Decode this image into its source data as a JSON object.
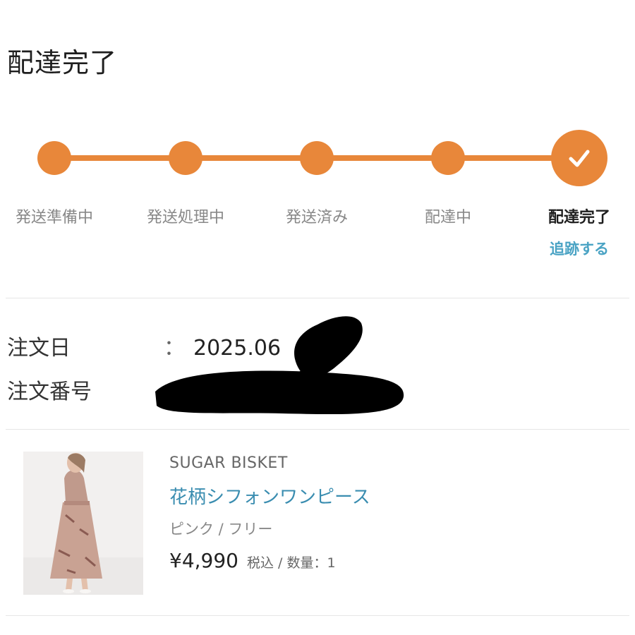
{
  "header": {
    "title": "配達完了"
  },
  "progress": {
    "accent_color": "#e8873a",
    "steps": [
      {
        "label": "発送準備中",
        "state": "done"
      },
      {
        "label": "発送処理中",
        "state": "done"
      },
      {
        "label": "発送済み",
        "state": "done"
      },
      {
        "label": "配達中",
        "state": "done"
      },
      {
        "label": "配達完了",
        "state": "current"
      }
    ],
    "check_icon": "check-icon",
    "tracking_link": "追跡する"
  },
  "order": {
    "date_label": "注文日",
    "date_colon": "：",
    "date_value": "2025.06",
    "number_label": "注文番号"
  },
  "product": {
    "brand": "SUGAR BISKET",
    "name": "花柄シフォンワンピース",
    "variant": "ピンク / フリー",
    "price": "¥4,990",
    "price_meta": "税込 / 数量：1"
  }
}
